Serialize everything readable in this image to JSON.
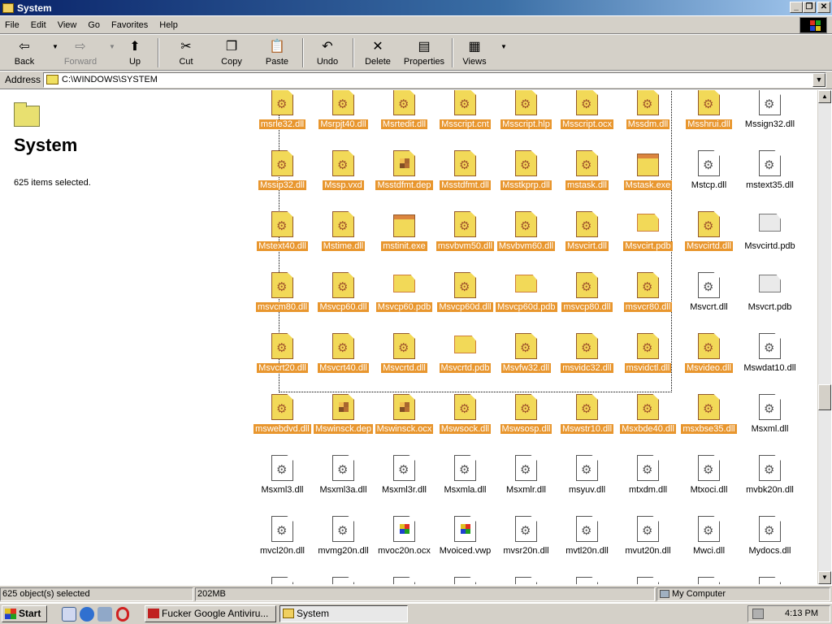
{
  "window": {
    "title": "System"
  },
  "menu": [
    "File",
    "Edit",
    "View",
    "Go",
    "Favorites",
    "Help"
  ],
  "toolbar": {
    "back": "Back",
    "forward": "Forward",
    "up": "Up",
    "cut": "Cut",
    "copy": "Copy",
    "paste": "Paste",
    "undo": "Undo",
    "delete": "Delete",
    "properties": "Properties",
    "views": "Views"
  },
  "address": {
    "label": "Address",
    "value": "C:\\WINDOWS\\SYSTEM"
  },
  "left": {
    "title": "System",
    "info": "625 items selected."
  },
  "files": [
    {
      "name": "msrle32.dll",
      "icon": "doc",
      "sel": true
    },
    {
      "name": "Msrpjt40.dll",
      "icon": "doc",
      "sel": true
    },
    {
      "name": "Msrtedit.dll",
      "icon": "doc",
      "sel": true
    },
    {
      "name": "Msscript.cnt",
      "icon": "doc",
      "sel": true
    },
    {
      "name": "Msscript.hlp",
      "icon": "doc",
      "sel": true
    },
    {
      "name": "Msscript.ocx",
      "icon": "doc",
      "sel": true
    },
    {
      "name": "Mssdm.dll",
      "icon": "doc",
      "sel": true
    },
    {
      "name": "Msshrui.dll",
      "icon": "doc",
      "sel": true
    },
    {
      "name": "Mssign32.dll",
      "icon": "doc",
      "sel": false
    },
    {
      "name": "Mssip32.dll",
      "icon": "doc",
      "sel": true
    },
    {
      "name": "Mssp.vxd",
      "icon": "doc",
      "sel": true
    },
    {
      "name": "Msstdfmt.dep",
      "icon": "win",
      "sel": true
    },
    {
      "name": "Msstdfmt.dll",
      "icon": "doc",
      "sel": true
    },
    {
      "name": "Msstkprp.dll",
      "icon": "doc",
      "sel": true
    },
    {
      "name": "mstask.dll",
      "icon": "doc",
      "sel": true
    },
    {
      "name": "Mstask.exe",
      "icon": "app",
      "sel": true
    },
    {
      "name": "Mstcp.dll",
      "icon": "doc",
      "sel": false
    },
    {
      "name": "mstext35.dll",
      "icon": "doc",
      "sel": false
    },
    {
      "name": "Mstext40.dll",
      "icon": "doc",
      "sel": true
    },
    {
      "name": "Mstime.dll",
      "icon": "doc",
      "sel": true
    },
    {
      "name": "mstinit.exe",
      "icon": "app",
      "sel": true
    },
    {
      "name": "msvbvm50.dll",
      "icon": "doc",
      "sel": true
    },
    {
      "name": "Msvbvm60.dll",
      "icon": "doc",
      "sel": true
    },
    {
      "name": "Msvcirt.dll",
      "icon": "doc",
      "sel": true
    },
    {
      "name": "Msvcirt.pdb",
      "icon": "pdb",
      "sel": true
    },
    {
      "name": "Msvcirtd.dll",
      "icon": "doc",
      "sel": true
    },
    {
      "name": "Msvcirtd.pdb",
      "icon": "pdb",
      "sel": false
    },
    {
      "name": "msvcm80.dll",
      "icon": "doc",
      "sel": true
    },
    {
      "name": "Msvcp60.dll",
      "icon": "doc",
      "sel": true
    },
    {
      "name": "Msvcp60.pdb",
      "icon": "pdb",
      "sel": true
    },
    {
      "name": "Msvcp60d.dll",
      "icon": "doc",
      "sel": true
    },
    {
      "name": "Msvcp60d.pdb",
      "icon": "pdb",
      "sel": true
    },
    {
      "name": "msvcp80.dll",
      "icon": "doc",
      "sel": true
    },
    {
      "name": "msvcr80.dll",
      "icon": "doc",
      "sel": true
    },
    {
      "name": "Msvcrt.dll",
      "icon": "doc",
      "sel": false
    },
    {
      "name": "Msvcrt.pdb",
      "icon": "pdb",
      "sel": false
    },
    {
      "name": "Msvcrt20.dll",
      "icon": "doc",
      "sel": true
    },
    {
      "name": "Msvcrt40.dll",
      "icon": "doc",
      "sel": true
    },
    {
      "name": "Msvcrtd.dll",
      "icon": "doc",
      "sel": true
    },
    {
      "name": "Msvcrtd.pdb",
      "icon": "pdb",
      "sel": true
    },
    {
      "name": "Msvfw32.dll",
      "icon": "doc",
      "sel": true
    },
    {
      "name": "msvidc32.dll",
      "icon": "doc",
      "sel": true
    },
    {
      "name": "msvidctl.dll",
      "icon": "doc",
      "sel": true
    },
    {
      "name": "Msvideo.dll",
      "icon": "doc",
      "sel": true
    },
    {
      "name": "Mswdat10.dll",
      "icon": "doc",
      "sel": false
    },
    {
      "name": "mswebdvd.dll",
      "icon": "doc",
      "sel": true
    },
    {
      "name": "Mswinsck.dep",
      "icon": "win",
      "sel": true
    },
    {
      "name": "Mswinsck.ocx",
      "icon": "win",
      "sel": true
    },
    {
      "name": "Mswsock.dll",
      "icon": "doc",
      "sel": true
    },
    {
      "name": "Mswsosp.dll",
      "icon": "doc",
      "sel": true
    },
    {
      "name": "Mswstr10.dll",
      "icon": "doc",
      "sel": true
    },
    {
      "name": "Msxbde40.dll",
      "icon": "doc",
      "sel": true
    },
    {
      "name": "msxbse35.dll",
      "icon": "doc",
      "sel": true
    },
    {
      "name": "Msxml.dll",
      "icon": "doc",
      "sel": false
    },
    {
      "name": "Msxml3.dll",
      "icon": "doc",
      "sel": false
    },
    {
      "name": "Msxml3a.dll",
      "icon": "doc",
      "sel": false
    },
    {
      "name": "Msxml3r.dll",
      "icon": "doc",
      "sel": false
    },
    {
      "name": "Msxmla.dll",
      "icon": "doc",
      "sel": false
    },
    {
      "name": "Msxmlr.dll",
      "icon": "doc",
      "sel": false
    },
    {
      "name": "msyuv.dll",
      "icon": "doc",
      "sel": false
    },
    {
      "name": "mtxdm.dll",
      "icon": "doc",
      "sel": false
    },
    {
      "name": "Mtxoci.dll",
      "icon": "doc",
      "sel": false
    },
    {
      "name": "mvbk20n.dll",
      "icon": "doc",
      "sel": false
    },
    {
      "name": "mvcl20n.dll",
      "icon": "doc",
      "sel": false
    },
    {
      "name": "mvmg20n.dll",
      "icon": "doc",
      "sel": false
    },
    {
      "name": "mvoc20n.ocx",
      "icon": "win",
      "sel": false
    },
    {
      "name": "Mvoiced.vwp",
      "icon": "win",
      "sel": false
    },
    {
      "name": "mvsr20n.dll",
      "icon": "doc",
      "sel": false
    },
    {
      "name": "mvtl20n.dll",
      "icon": "doc",
      "sel": false
    },
    {
      "name": "mvut20n.dll",
      "icon": "doc",
      "sel": false
    },
    {
      "name": "Mwci.dll",
      "icon": "doc",
      "sel": false
    },
    {
      "name": "Mydocs.dll",
      "icon": "doc",
      "sel": false
    },
    {
      "name": "",
      "icon": "win",
      "sel": false
    },
    {
      "name": "",
      "icon": "doc",
      "sel": false
    },
    {
      "name": "",
      "icon": "doc",
      "sel": false
    },
    {
      "name": "",
      "icon": "doc",
      "sel": false
    },
    {
      "name": "",
      "icon": "doc",
      "sel": false
    },
    {
      "name": "",
      "icon": "doc",
      "sel": false
    },
    {
      "name": "",
      "icon": "doc",
      "sel": false
    },
    {
      "name": "",
      "icon": "doc",
      "sel": false
    },
    {
      "name": "",
      "icon": "doc",
      "sel": false
    }
  ],
  "status": {
    "selected": "625 object(s) selected",
    "size": "202MB",
    "zone": "My Computer"
  },
  "taskbar": {
    "start": "Start",
    "tasks": [
      "Fucker Google Antiviru...",
      "System"
    ],
    "clock": "4:13 PM"
  }
}
